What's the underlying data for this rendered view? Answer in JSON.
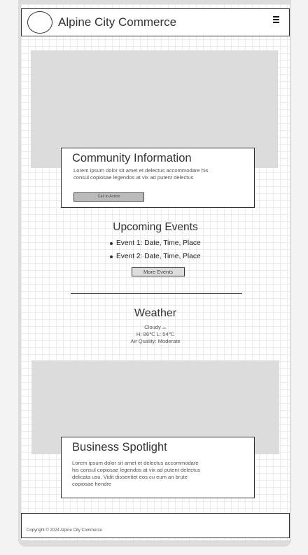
{
  "header": {
    "site_title": "Alpine City Commerce",
    "menu_icon": "hamburger-menu-icon"
  },
  "community": {
    "title": "Community Information",
    "body": "Lorem ipsum dolor sit amet et delectus accommodare his consul copiosae legendos at vix ad putent delectus",
    "cta_label": "Call to Action"
  },
  "events": {
    "title": "Upcoming Events",
    "items": [
      "Event 1: Date, Time, Place",
      "Event 2: Date, Time, Place"
    ],
    "more_label": "More Events"
  },
  "weather": {
    "title": "Weather",
    "condition": "Cloudy",
    "condition_icon": "cloud-icon",
    "temps": "H: 86℃ L: 54℃",
    "air_quality": "Air Quality: Moderate"
  },
  "spotlight": {
    "title": "Business Spotlight",
    "body": "Lorem ipsum dolor sit amet et delectus accommodare his consul copiosae legendos at vix ad putent delectus delicata usu. Vidit dissentiet eos cu eum an brute copiosae hendre"
  },
  "footer": {
    "copyright": "Copyright © 2024 Alpine City Commerce"
  },
  "colors": {
    "placeholder_gray": "#dcdcdc",
    "border": "#333333",
    "button_gray": "#bbbbbb"
  }
}
